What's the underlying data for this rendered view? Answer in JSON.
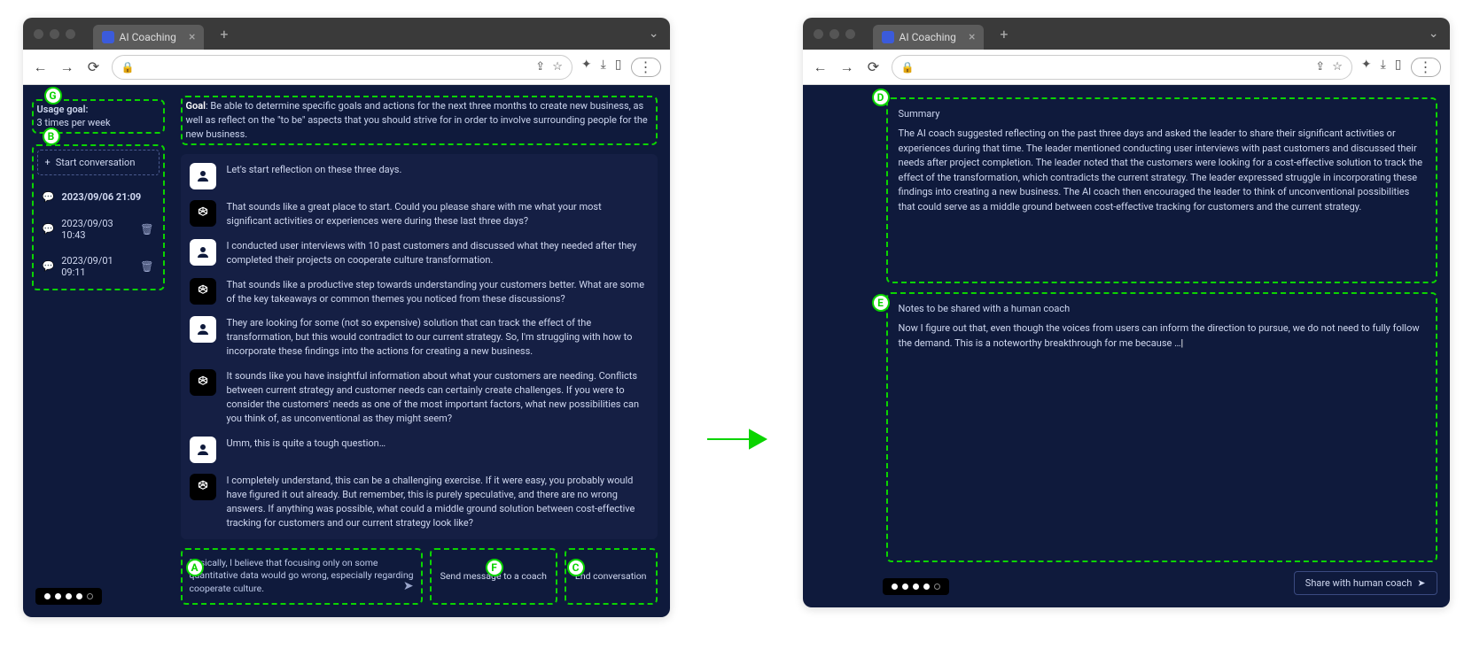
{
  "browser": {
    "tab_title": "AI Coaching",
    "url_lock": "🔒"
  },
  "left": {
    "usage_goal_label": "Usage goal:",
    "usage_goal_value": "3 times per week",
    "start_conversation_label": "Start conversation",
    "conversations": [
      {
        "timestamp": "2023/09/06 21:09",
        "active": true
      },
      {
        "timestamp": "2023/09/03 10:43",
        "active": false
      },
      {
        "timestamp": "2023/09/01 09:11",
        "active": false
      }
    ],
    "goal_label": "Goal",
    "goal_text": ": Be able to determine specific goals and actions for the next three months to create new business, as well as reflect on the \"to be\" aspects that you should strive for in order to involve surrounding people for the new business.",
    "messages": [
      {
        "role": "user",
        "text": "Let's start reflection on these three days."
      },
      {
        "role": "ai",
        "text": "That sounds like a great place to start. Could you please share with me what your most significant activities or experiences were during these last three days?"
      },
      {
        "role": "user",
        "text": "I conducted user interviews with 10 past customers and discussed what they needed after they completed their projects on cooperate culture transformation."
      },
      {
        "role": "ai",
        "text": "That sounds like a productive step towards understanding your customers better. What are some of the key takeaways or common themes you noticed from these discussions?"
      },
      {
        "role": "user",
        "text": "They are looking for some (not so expensive) solution that can track the effect of the transformation, but this would contradict to our current strategy. So, I'm struggling with how to incorporate these findings into the actions for creating a new business."
      },
      {
        "role": "ai",
        "text": "It sounds like you have insightful information about what your customers are needing. Conflicts between current strategy and customer needs can certainly create challenges. If you were to consider the customers' needs as one of the most important factors, what new possibilities can you think of, as unconventional as they might seem?"
      },
      {
        "role": "user",
        "text": "Umm, this is quite a tough question…"
      },
      {
        "role": "ai",
        "text": "I completely understand, this can be a challenging exercise. If it were easy, you probably would have figured it out already. But remember, this is purely speculative, and there are no wrong answers. If anything was possible, what could a middle ground solution between cost-effective tracking for customers and our current strategy look like?"
      }
    ],
    "compose_text": "Basically, I believe that focusing only on some quantitative data would go wrong, especially regarding cooperate culture.",
    "send_to_coach_label": "Send message to a coach",
    "end_conversation_label": "End conversation",
    "pager_active_index": 3,
    "pager_total": 5
  },
  "right": {
    "summary_title": "Summary",
    "summary_body": "The AI coach suggested reflecting on the past three days and asked the leader to share their significant activities or experiences during that time. The leader mentioned conducting user interviews with past customers and discussed their needs after project completion. The leader noted that the customers were looking for a cost-effective solution to track the effect of the transformation, which contradicts the current strategy. The leader expressed struggle in incorporating these findings into creating a new business. The AI coach then encouraged the leader to think of unconventional possibilities that could serve as a middle ground between cost-effective tracking for customers and the current strategy.",
    "notes_title": "Notes to be shared with a human coach",
    "notes_body": "Now I figure out that, even though the voices from users can inform the direction to pursue, we do not need to fully follow the demand. This is a noteworthy breakthrough for me because …",
    "share_button_label": "Share with human coach",
    "pager_active_index": 4,
    "pager_total": 5
  },
  "annotations": {
    "A": "A",
    "B": "B",
    "C": "C",
    "D": "D",
    "E": "E",
    "F": "F",
    "G": "G"
  }
}
